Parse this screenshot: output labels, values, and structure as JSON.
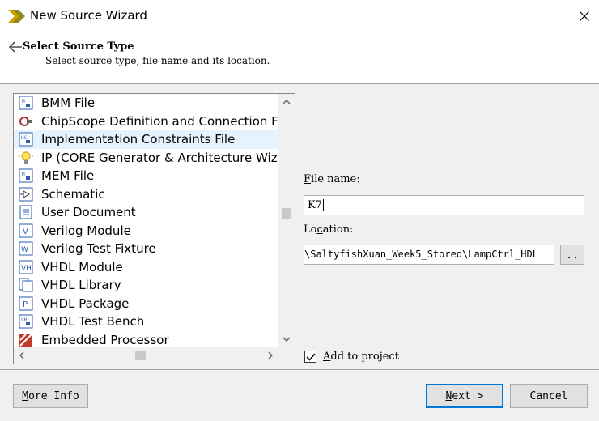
{
  "window": {
    "title": "New Source Wizard",
    "close_icon": "close-icon",
    "app_icon": "xilinx-logo-icon"
  },
  "header": {
    "title": "Select Source Type",
    "subtitle": "Select source type, file name and its location."
  },
  "source_list": {
    "selected_index": 2,
    "items": [
      {
        "label": "BMM File",
        "icon": "bmm-file-icon"
      },
      {
        "label": "ChipScope Definition and Connection File",
        "icon": "chipscope-icon"
      },
      {
        "label": "Implementation Constraints File",
        "icon": "constraints-file-icon"
      },
      {
        "label": "IP (CORE Generator & Architecture Wizard)",
        "icon": "ip-core-icon"
      },
      {
        "label": "MEM File",
        "icon": "mem-file-icon"
      },
      {
        "label": "Schematic",
        "icon": "schematic-icon"
      },
      {
        "label": "User Document",
        "icon": "document-icon"
      },
      {
        "label": "Verilog Module",
        "icon": "verilog-module-icon"
      },
      {
        "label": "Verilog Test Fixture",
        "icon": "verilog-test-icon"
      },
      {
        "label": "VHDL Module",
        "icon": "vhdl-module-icon"
      },
      {
        "label": "VHDL Library",
        "icon": "vhdl-library-icon"
      },
      {
        "label": "VHDL Package",
        "icon": "vhdl-package-icon"
      },
      {
        "label": "VHDL Test Bench",
        "icon": "vhdl-testbench-icon"
      },
      {
        "label": "Embedded Processor",
        "icon": "embedded-processor-icon"
      }
    ]
  },
  "form": {
    "filename_label_accel": "F",
    "filename_label_rest": "ile name:",
    "filename_value": "K7",
    "location_label_pre": "Lo",
    "location_label_accel": "c",
    "location_label_rest": "ation:",
    "location_value": "\\SaltyfishXuan_Week5_Stored\\LampCtrl_HDL",
    "browse_label": "..",
    "add_to_project_accel": "A",
    "add_to_project_rest": "dd to project",
    "add_to_project_checked": true
  },
  "buttons": {
    "more_info_accel": "M",
    "more_info_rest": "ore Info",
    "next_accel": "N",
    "next_rest": "ext >",
    "cancel": "Cancel"
  },
  "colors": {
    "selection": "#e5f3ff",
    "default_button_border": "#0078d7",
    "dialog_bg": "#f0f0f0"
  }
}
